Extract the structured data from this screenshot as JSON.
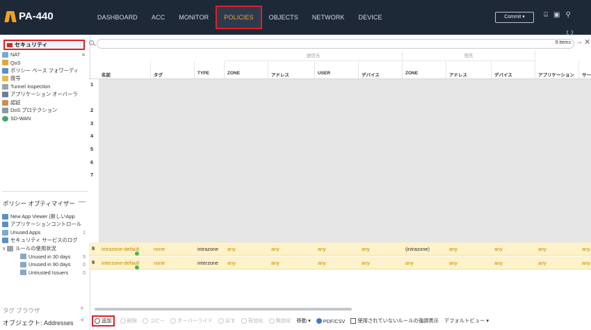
{
  "app": {
    "logo": "PA-440",
    "nav_tabs": [
      "DASHBOARD",
      "ACC",
      "MONITOR",
      "POLICIES",
      "OBJECTS",
      "NETWORK",
      "DEVICE"
    ],
    "active_tab": "POLICIES",
    "commit_label": "Commit ▾",
    "accent": "#f7a21b",
    "highlight": "#e01f26"
  },
  "sidebar": {
    "selected": "セキュリティ",
    "items": [
      {
        "label": "NAT",
        "icon": "nat-icon",
        "count": "∗"
      },
      {
        "label": "QoS",
        "icon": "qos-icon"
      },
      {
        "label": "ポリシー ベース フォワーディ",
        "icon": "pbf-icon"
      },
      {
        "label": "復号",
        "icon": "decryption-icon"
      },
      {
        "label": "Tunnel Inspection",
        "icon": "tunnel-icon"
      },
      {
        "label": "アプリケーション オーバーラ",
        "icon": "app-override-icon"
      },
      {
        "label": "認証",
        "icon": "auth-icon"
      },
      {
        "label": "DoS プロテクション",
        "icon": "dos-icon"
      },
      {
        "label": "SD-WAN",
        "icon": "sdwan-icon"
      }
    ],
    "optimizer": {
      "title": "ポリシー オプティマイザー",
      "collapse": "—",
      "items": [
        {
          "label": "New App Viewer (新しいApp",
          "icon": "new-app-viewer-icon"
        },
        {
          "label": "アプリケーションコントロール",
          "icon": "app-control-icon"
        },
        {
          "label": "Unused Apps",
          "icon": "unused-apps-icon",
          "count": "1"
        },
        {
          "label": "セキュリティ サービスのログ",
          "icon": "security-services-icon"
        },
        {
          "label": "ルールの使用状況",
          "icon": "rule-usage-icon",
          "expander": "∨"
        },
        {
          "label": "Unused in 30 days",
          "icon": "unused30-icon",
          "count": "5"
        },
        {
          "label": "Unused in 90 days",
          "icon": "unused90-icon",
          "count": "0"
        },
        {
          "label": "Untrusted Issuers",
          "icon": "untrusted-icon",
          "count": "0"
        }
      ]
    },
    "tag_browser": "タグ ブラウザ",
    "objects_label": "オブジェクト: Addresses",
    "plus": "+"
  },
  "search": {
    "placeholder": "",
    "items_count": "9 items",
    "go": "→",
    "clear": "✕"
  },
  "grid": {
    "group_source": "送信元",
    "group_dest": "宛先",
    "columns": [
      "名前",
      "タグ",
      "TYPE",
      "ZONE",
      "アドレス",
      "USER",
      "デバイス",
      "ZONE",
      "アドレス",
      "デバイス",
      "アプリケーション",
      "サー"
    ],
    "hidden_rows": [
      "1",
      "2",
      "3",
      "4",
      "5",
      "6",
      "7"
    ],
    "rows": [
      {
        "num": "8",
        "name": "intrazone-default",
        "tag": "none",
        "type": "intrazone",
        "src_zone": "any",
        "src_addr": "any",
        "user": "any",
        "src_dev": "any",
        "dst_zone": "(intrazone)",
        "dst_addr": "any",
        "dst_dev": "any",
        "app": "any",
        "svc": "any"
      },
      {
        "num": "9",
        "name": "interzone-default",
        "tag": "none",
        "type": "interzone",
        "src_zone": "any",
        "src_addr": "any",
        "user": "any",
        "src_dev": "any",
        "dst_zone": "any",
        "dst_addr": "any",
        "dst_dev": "any",
        "app": "any",
        "svc": "any"
      }
    ]
  },
  "toolbar": {
    "add": "追加",
    "delete": "削除",
    "copy": "コピー",
    "override": "オーバーライド",
    "revert": "戻す",
    "enable": "有効化",
    "disable": "無効化",
    "move": "移動 ▾",
    "pdf": "PDF/CSV",
    "highlight_unused": "使用されていないルールの強調表示",
    "default_view": "デフォルトビュー ▾"
  }
}
